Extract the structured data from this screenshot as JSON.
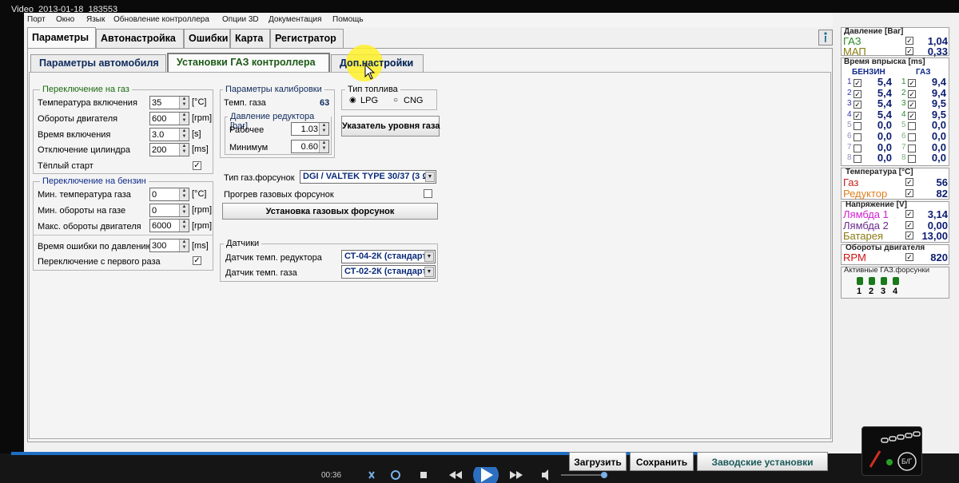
{
  "window": {
    "title": "Video_2013-01-18_183553"
  },
  "menu": [
    "Порт",
    "Окно",
    "Язык",
    "Обновление контроллера",
    "Опции 3D",
    "Документация",
    "Помощь"
  ],
  "main_tabs": [
    "Параметры",
    "Автонастройка",
    "Ошибки",
    "Карта",
    "Регистратор"
  ],
  "sub_tabs": [
    "Параметры автомобиля",
    "Установки ГАЗ контроллера",
    "Доп.настройки"
  ],
  "switch_gas": {
    "title": "Переключение на газ",
    "rows": [
      {
        "label": "Температура включения",
        "value": "35",
        "unit": "[°C]"
      },
      {
        "label": "Обороты двигателя",
        "value": "600",
        "unit": "[rpm]"
      },
      {
        "label": "Время включения",
        "value": "3.0",
        "unit": "[s]"
      },
      {
        "label": "Отключение цилиндра",
        "value": "200",
        "unit": "[ms]"
      }
    ],
    "warm_start": "Тёплый старт"
  },
  "switch_petrol": {
    "title": "Переключение на бензин",
    "rows": [
      {
        "label": "Мин. температура газа",
        "value": "0",
        "unit": "[°C]"
      },
      {
        "label": "Мин. обороты на газе",
        "value": "0",
        "unit": "[rpm]"
      },
      {
        "label": "Макс. обороты двигателя",
        "value": "6000",
        "unit": "[rpm]"
      }
    ],
    "pressure_error": {
      "label": "Время ошибки по давлению",
      "value": "300",
      "unit": "[ms]"
    },
    "first_time": "Переключение с первого раза"
  },
  "calibration": {
    "title": "Параметры калибровки",
    "gas_temp_label": "Темп. газа",
    "gas_temp_value": "63",
    "reducer_title": "Давление редуктора [bar]",
    "work_label": "Рабочее",
    "work_value": "1.03",
    "min_label": "Минимум",
    "min_value": "0.60"
  },
  "fuel_type": {
    "title": "Тип топлива",
    "lpg": "LPG",
    "cng": "CNG"
  },
  "level_button": "Указатель уровня газа",
  "injectors": {
    "type_label": "Тип газ.форсунок",
    "type_value": "DGI / VALTEK TYPE 30/37 (3 Ω)",
    "preheat_label": "Прогрев газовых форсунок",
    "setup_button": "Установка газовых форсунок"
  },
  "sensors": {
    "title": "Датчики",
    "reducer_label": "Датчик темп. редуктора",
    "reducer_value": "СТ-04-2К (стандарт",
    "gas_label": "Датчик темп. газа",
    "gas_value": "СТ-02-2К (стандарт"
  },
  "buttons": {
    "load": "Загрузить",
    "save": "Сохранить",
    "factory": "Заводские установки"
  },
  "right": {
    "pressure_title": "Давление [Bar]",
    "pressure": [
      {
        "name": "ГАЗ",
        "value": "1,04",
        "color": "#2a8a2a"
      },
      {
        "name": "МАП",
        "value": "0,33",
        "color": "#8a7a10"
      }
    ],
    "injection_title": "Время впрыска [ms]",
    "petrol_col": "БЕНЗИН",
    "gas_col": "ГАЗ",
    "inj_rows": [
      {
        "n": "1",
        "p": "5,4",
        "g": "9,4"
      },
      {
        "n": "2",
        "p": "5,4",
        "g": "9,4"
      },
      {
        "n": "3",
        "p": "5,4",
        "g": "9,5"
      },
      {
        "n": "4",
        "p": "5,4",
        "g": "9,5"
      },
      {
        "n": "5",
        "p": "0,0",
        "g": "0,0"
      },
      {
        "n": "6",
        "p": "0,0",
        "g": "0,0"
      },
      {
        "n": "7",
        "p": "0,0",
        "g": "0,0"
      },
      {
        "n": "8",
        "p": "0,0",
        "g": "0,0"
      }
    ],
    "temp_title": "Температура [°C]",
    "temps": [
      {
        "name": "Газ",
        "value": "56",
        "color": "#c0201a"
      },
      {
        "name": "Редуктор",
        "value": "82",
        "color": "#e08020"
      }
    ],
    "volt_title": "Напряжение [V]",
    "volts": [
      {
        "name": "Лямбда 1",
        "value": "3,14",
        "color": "#d020d0"
      },
      {
        "name": "Лямбда 2",
        "value": "0,00",
        "color": "#6a2a8a"
      },
      {
        "name": "Батарея",
        "value": "13,00",
        "color": "#8a7a10"
      }
    ],
    "rpm_title": "Обороты двигателя",
    "rpm": {
      "name": "RPM",
      "value": "820",
      "color": "#d01010"
    },
    "active_title": "Активные ГАЗ.форсунки",
    "active": [
      "1",
      "2",
      "3",
      "4"
    ]
  },
  "player": {
    "time": "00:36"
  },
  "logo": {
    "badge": "Б/Г"
  }
}
